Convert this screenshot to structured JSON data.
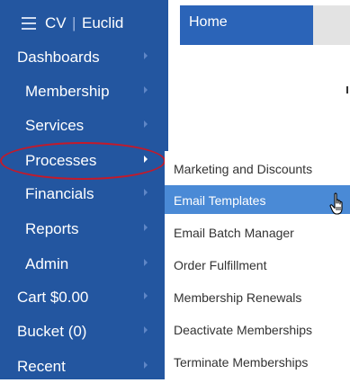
{
  "brand": {
    "abbr": "CV",
    "separator": "|",
    "name": "Euclid"
  },
  "header": {
    "tab_label": "Home"
  },
  "sidebar": {
    "items": [
      {
        "label": "Dashboards"
      },
      {
        "label": "Membership"
      },
      {
        "label": "Services"
      },
      {
        "label": "Processes",
        "active": true
      },
      {
        "label": "Financials"
      },
      {
        "label": "Reports"
      },
      {
        "label": "Admin"
      },
      {
        "label": "Cart $0.00"
      },
      {
        "label": "Bucket (0)"
      },
      {
        "label": "Recent"
      }
    ]
  },
  "submenu": {
    "items": [
      {
        "label": "Marketing and Discounts"
      },
      {
        "label": "Email Templates",
        "selected": true
      },
      {
        "label": "Email Batch Manager"
      },
      {
        "label": "Order Fulfillment"
      },
      {
        "label": "Membership Renewals"
      },
      {
        "label": "Deactivate Memberships"
      },
      {
        "label": "Terminate Memberships"
      }
    ]
  },
  "colors": {
    "sidebar_bg": "#2356a0",
    "tab_bg": "#2b64b8",
    "selected_bg": "#4a8ad6",
    "annotation": "#c41a2a"
  },
  "icons": {
    "menu": "hamburger-icon",
    "chevron": "chevron-right-icon",
    "pointer": "hand-pointer-icon"
  }
}
